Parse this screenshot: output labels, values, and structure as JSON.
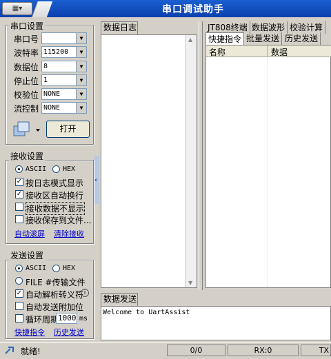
{
  "window": {
    "title": "串口调试助手"
  },
  "serial": {
    "group_title": "串口设置",
    "port_label": "串口号",
    "port_value": "",
    "baud_label": "波特率",
    "baud_value": "115200",
    "databits_label": "数据位",
    "databits_value": "8",
    "stopbits_label": "停止位",
    "stopbits_value": "1",
    "parity_label": "校验位",
    "parity_value": "NONE",
    "flow_label": "流控制",
    "flow_value": "NONE",
    "open_button": "打开"
  },
  "receive": {
    "group_title": "接收设置",
    "ascii": "ASCII",
    "hex": "HEX",
    "log_mode": "按日志模式显示",
    "auto_newline": "接收区自动换行",
    "hide_data": "接收数据不显示",
    "save_file": "接收保存到文件...",
    "auto_scroll": "自动滚屏",
    "clear": "清除接收"
  },
  "send": {
    "group_title": "发送设置",
    "ascii": "ASCII",
    "hex": "HEX",
    "file": "FILE #传输文件",
    "auto_escape": "自动解析转义符",
    "auto_append": "自动发送附加位",
    "loop_label": "循环周期",
    "loop_value": "1000",
    "loop_unit": "ms",
    "quick": "快捷指令",
    "history": "历史发送"
  },
  "log": {
    "tab": "数据日志"
  },
  "right_tabs_row1": [
    "JT808终端",
    "数据波形",
    "校验计算"
  ],
  "right_tabs_row2": [
    "快捷指令",
    "批量发送",
    "历史发送"
  ],
  "table": {
    "col_name": "名称",
    "col_data": "数据"
  },
  "datasend": {
    "tab": "数据发送",
    "text": "Welcome to UartAssist"
  },
  "status": {
    "ready": "就绪!",
    "count": "0/0",
    "rx": "RX:0",
    "tx": "TX"
  }
}
